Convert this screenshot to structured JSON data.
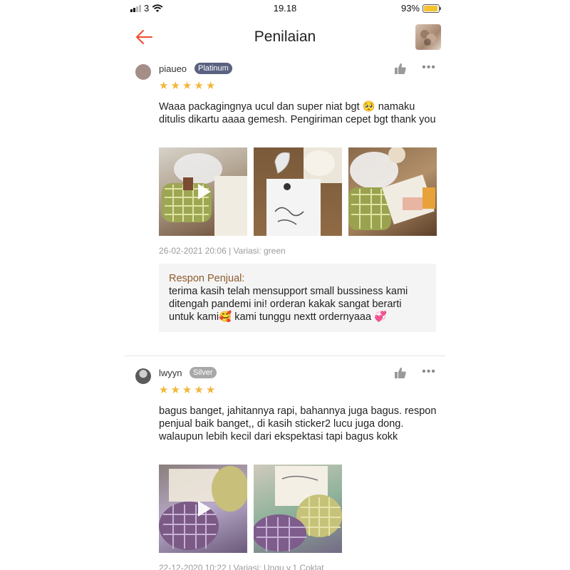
{
  "status": {
    "carrier": "3",
    "time": "19.18",
    "battery_percent_label": "93%",
    "battery_level": 0.93,
    "battery_color": "#f3c331"
  },
  "header": {
    "back_icon": "arrow-left-icon",
    "title": "Penilaian",
    "accent": "#ee4d2d"
  },
  "reviews": [
    {
      "username": "piaueo",
      "badge": "Platinum",
      "badge_color": "#5b6280",
      "rating": 5,
      "text": "Waaa packagingnya ucul dan super niat bgt 🥺 namaku ditulis dikartu aaaa gemesh. Pengiriman cepet bgt thank you",
      "meta": "26-02-2021 20:06 | Variasi: green",
      "media_count": 3,
      "seller_response": {
        "title": "Respon Penjual:",
        "text": "terima kasih telah mensupport small bussiness kami ditengah pandemi ini! orderan kakak sangat berarti untuk kami🥰 kami tunggu nextt ordernyaaa 💞"
      }
    },
    {
      "username": "lwyyn",
      "badge": "Silver",
      "badge_color": "#a8a8a8",
      "rating": 5,
      "text": "bagus banget, jahitannya rapi, bahannya juga bagus. respon penjual baik banget,, di kasih sticker2 lucu juga dong. walaupun lebih kecil dari ekspektasi tapi bagus kokk",
      "meta": "22-12-2020 10:22 | Variasi: Ungu,v.1 Coklat",
      "media_count": 2
    }
  ]
}
